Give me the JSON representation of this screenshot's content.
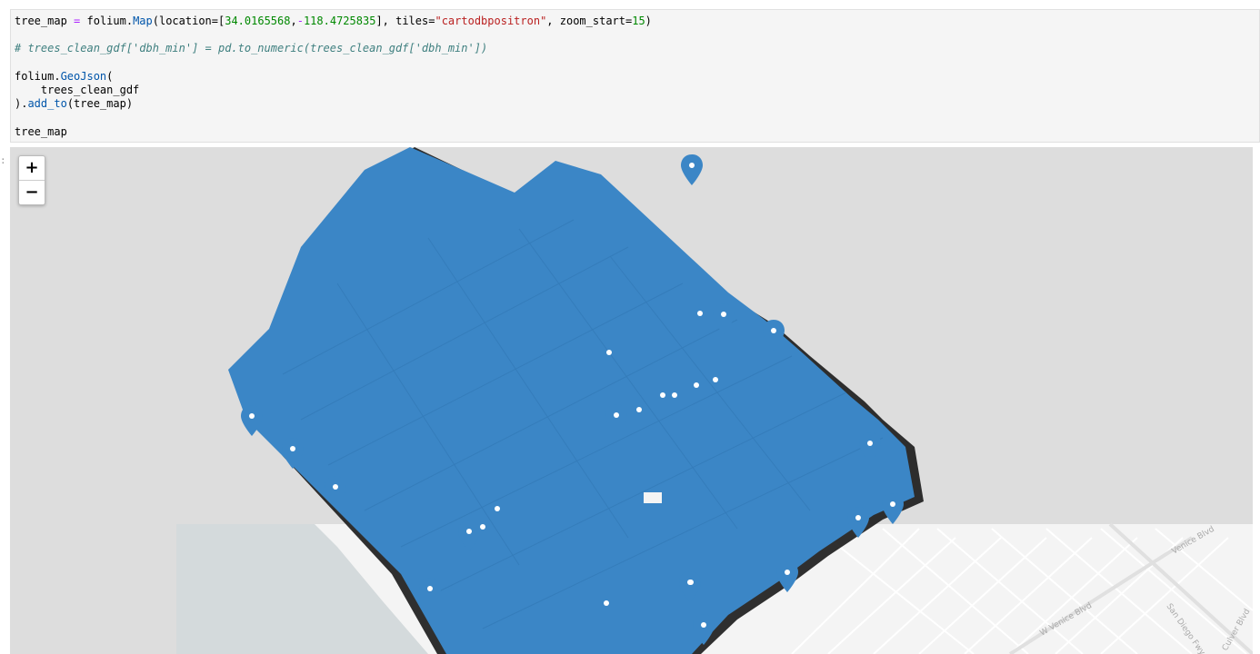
{
  "code": {
    "var1": "tree_map",
    "folium_map": "folium.Map(location=[34.0165568,-118.4725835], tiles=\"cartodbpositron\", zoom_start=15)",
    "comment": "# trees_clean_gdf['dbh_min'] = pd.to_numeric(trees_clean_gdf['dbh_min'])",
    "geojson_open": "folium.GeoJson(",
    "geojson_arg": "    trees_clean_gdf",
    "geojson_close": ").add_to(tree_map)",
    "last_line": "tree_map",
    "loc_lat": "34.0165568",
    "loc_lon": "-118.4725835",
    "tiles": "\"cartodbpositron\"",
    "zoom": "15"
  },
  "output_prompt": ":",
  "map": {
    "zoom_in_label": "+",
    "zoom_out_label": "−",
    "street_labels": [
      "W Venice Blvd",
      "Venice Blvd",
      "San Diego Fwy",
      "Culver Blvd"
    ],
    "marker_color": "#3b86c6",
    "land_color": "#f2f2f2",
    "water_color": "#d4dadc",
    "grey_overlay": "#dddddd"
  }
}
